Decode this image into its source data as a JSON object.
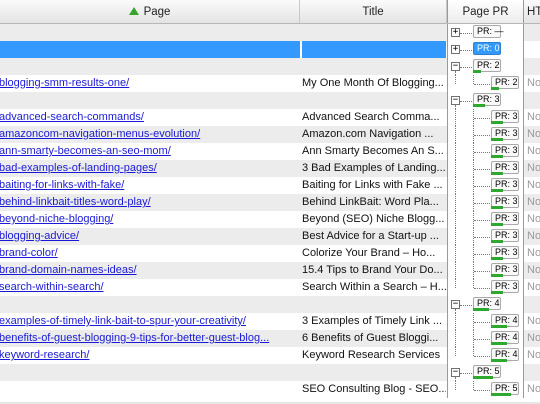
{
  "columns": {
    "page": "Page",
    "title": "Title",
    "pr": "Page PR",
    "ht": "HT"
  },
  "colors": {
    "selection": "#3399ff",
    "link": "#1a1ad6",
    "pr_bar": "#2ea82e",
    "sort_arrow": "#37a42c"
  },
  "rows": [
    {
      "page": "",
      "title": "",
      "pr": "PR: —",
      "level": 0,
      "toggle": "+",
      "ht": ""
    },
    {
      "page": "",
      "title": "",
      "pr": "PR: 0",
      "level": 0,
      "toggle": "+",
      "ht": "",
      "selected": true
    },
    {
      "page": "",
      "title": "",
      "pr": "PR: 2",
      "level": 0,
      "toggle": "−",
      "ht": "",
      "bar": 0.2
    },
    {
      "page": "blogging-smm-results-one/",
      "title": "My One Month Of Blogging...",
      "pr": "PR: 2",
      "level": 1,
      "ht": "No",
      "bar": 0.2
    },
    {
      "page": "",
      "title": "",
      "pr": "PR: 3",
      "level": 0,
      "toggle": "−",
      "ht": "",
      "bar": 0.3
    },
    {
      "page": "advanced-search-commands/",
      "title": "Advanced Search Comma...",
      "pr": "PR: 3",
      "level": 1,
      "ht": "No",
      "bar": 0.3
    },
    {
      "page": "amazoncom-navigation-menus-evolution/",
      "title": "Amazon.com Navigation ...",
      "pr": "PR: 3",
      "level": 1,
      "ht": "No",
      "bar": 0.3
    },
    {
      "page": "ann-smarty-becomes-an-seo-mom/",
      "title": "Ann Smarty Becomes An S...",
      "pr": "PR: 3",
      "level": 1,
      "ht": "No",
      "bar": 0.3
    },
    {
      "page": "bad-examples-of-landing-pages/",
      "title": "3 Bad Examples of Landing...",
      "pr": "PR: 3",
      "level": 1,
      "ht": "No",
      "bar": 0.3
    },
    {
      "page": "baiting-for-links-with-fake/",
      "title": "Baiting for Links with Fake ...",
      "pr": "PR: 3",
      "level": 1,
      "ht": "No",
      "bar": 0.3
    },
    {
      "page": "behind-linkbait-titles-word-play/",
      "title": "Behind LinkBait: Word Pla...",
      "pr": "PR: 3",
      "level": 1,
      "ht": "No",
      "bar": 0.3
    },
    {
      "page": "beyond-niche-blogging/",
      "title": "Beyond (SEO) Niche Blogg...",
      "pr": "PR: 3",
      "level": 1,
      "ht": "No",
      "bar": 0.3
    },
    {
      "page": "blogging-advice/",
      "title": "Best Advice for a Start-up ...",
      "pr": "PR: 3",
      "level": 1,
      "ht": "No",
      "bar": 0.3
    },
    {
      "page": "brand-color/",
      "title": "Colorize Your Brand – Ho...",
      "pr": "PR: 3",
      "level": 1,
      "ht": "No",
      "bar": 0.3
    },
    {
      "page": "brand-domain-names-ideas/",
      "title": "15.4 Tips to Brand Your Do...",
      "pr": "PR: 3",
      "level": 1,
      "ht": "No",
      "bar": 0.3
    },
    {
      "page": "search-within-search/",
      "title": "Search Within a Search – H...",
      "pr": "PR: 3",
      "level": 1,
      "ht": "No",
      "bar": 0.3
    },
    {
      "page": "",
      "title": "",
      "pr": "PR: 4",
      "level": 0,
      "toggle": "−",
      "ht": "",
      "bar": 0.4
    },
    {
      "page": "examples-of-timely-link-bait-to-spur-your-creativity/",
      "title": "3 Examples of Timely Link ...",
      "pr": "PR: 4",
      "level": 1,
      "ht": "No",
      "bar": 0.4
    },
    {
      "page": "benefits-of-guest-blogging-9-tips-for-better-guest-blog...",
      "title": "6 Benefits of Guest Bloggi...",
      "pr": "PR: 4",
      "level": 1,
      "ht": "No",
      "bar": 0.4
    },
    {
      "page": "keyword-research/",
      "title": "Keyword Research Services",
      "pr": "PR: 4",
      "level": 1,
      "ht": "No",
      "bar": 0.4
    },
    {
      "page": "",
      "title": "",
      "pr": "PR: 5",
      "level": 0,
      "toggle": "−",
      "ht": "",
      "bar": 0.5
    },
    {
      "page": "",
      "title": "SEO Consulting Blog - SEO...",
      "pr": "PR: 5",
      "level": 1,
      "ht": "No",
      "bar": 0.5
    }
  ]
}
